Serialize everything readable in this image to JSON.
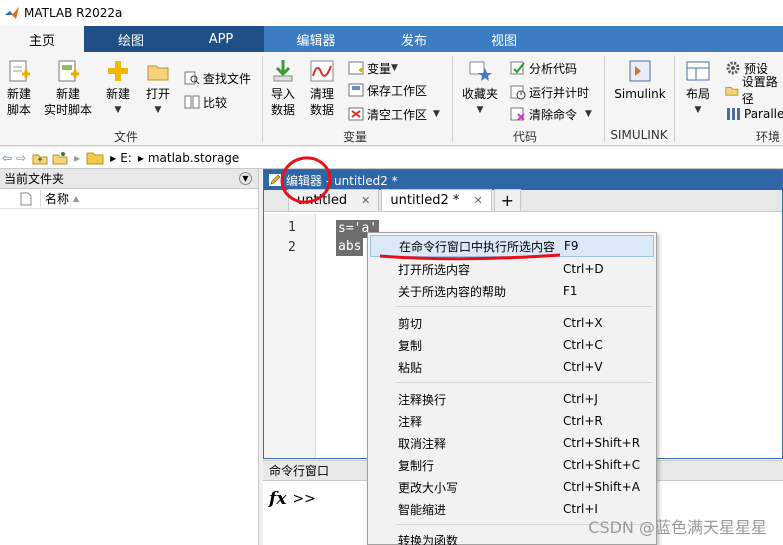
{
  "window": {
    "title": "MATLAB R2022a"
  },
  "tabs": [
    {
      "label": "主页"
    },
    {
      "label": "绘图"
    },
    {
      "label": "APP"
    },
    {
      "label": "编辑器"
    },
    {
      "label": "发布"
    },
    {
      "label": "视图"
    }
  ],
  "ribbon": {
    "file": {
      "new_script": "新建\n脚本",
      "new_live_script": "新建\n实时脚本",
      "new": "新建",
      "open": "打开",
      "find_files": "查找文件",
      "compare": "比较",
      "group_label": "文件"
    },
    "variable": {
      "import": "导入\n数据",
      "clean": "清理\n数据",
      "variable": "变量",
      "save_workspace": "保存工作区",
      "clear_workspace": "清空工作区",
      "group_label": "变量"
    },
    "code": {
      "favorites": "收藏夹",
      "analyze_code": "分析代码",
      "run_and_time": "运行并计时",
      "clear_commands": "清除命令",
      "group_label": "代码"
    },
    "simulink": {
      "button": "Simulink",
      "group_label": "SIMULINK"
    },
    "environment": {
      "layout": "布局",
      "preferences": "预设",
      "set_path": "设置路径",
      "parallel": "Paralle",
      "group_label": "环境"
    }
  },
  "address": {
    "drive": "E:",
    "folder": "matlab.storage"
  },
  "left_panel": {
    "title": "当前文件夹",
    "name_column": "名称"
  },
  "editor": {
    "header": "编辑器 - untitled2 *",
    "tabs": [
      {
        "label": "untitled"
      },
      {
        "label": "untitled2 *"
      }
    ],
    "add_tab": "+",
    "lines": [
      {
        "no": "1",
        "code": "s='a'"
      },
      {
        "no": "2",
        "code": "abs"
      }
    ]
  },
  "command_window": {
    "title": "命令行窗口",
    "fx": "fx",
    "prompt": ">>"
  },
  "context_menu": {
    "items": [
      {
        "label": "在命令行窗口中执行所选内容",
        "shortcut": "F9"
      },
      {
        "label": "打开所选内容",
        "shortcut": "Ctrl+D"
      },
      {
        "label": "关于所选内容的帮助",
        "shortcut": "F1"
      },
      {
        "label": "剪切",
        "shortcut": "Ctrl+X"
      },
      {
        "label": "复制",
        "shortcut": "Ctrl+C"
      },
      {
        "label": "粘贴",
        "shortcut": "Ctrl+V"
      },
      {
        "label": "注释换行",
        "shortcut": "Ctrl+J"
      },
      {
        "label": "注释",
        "shortcut": "Ctrl+R"
      },
      {
        "label": "取消注释",
        "shortcut": "Ctrl+Shift+R"
      },
      {
        "label": "复制行",
        "shortcut": "Ctrl+Shift+C"
      },
      {
        "label": "更改大小写",
        "shortcut": "Ctrl+Shift+A"
      },
      {
        "label": "智能缩进",
        "shortcut": "Ctrl+I"
      },
      {
        "label": "转换为函数",
        "shortcut": ""
      }
    ]
  },
  "watermark": "CSDN @蓝色满天星星星",
  "colors": {
    "tab_bar": "#1e4f86",
    "editor_tab_group": "#3b7cc2",
    "annotation_red": "#e8101a",
    "menu_highlight": "#dbe8f6"
  }
}
